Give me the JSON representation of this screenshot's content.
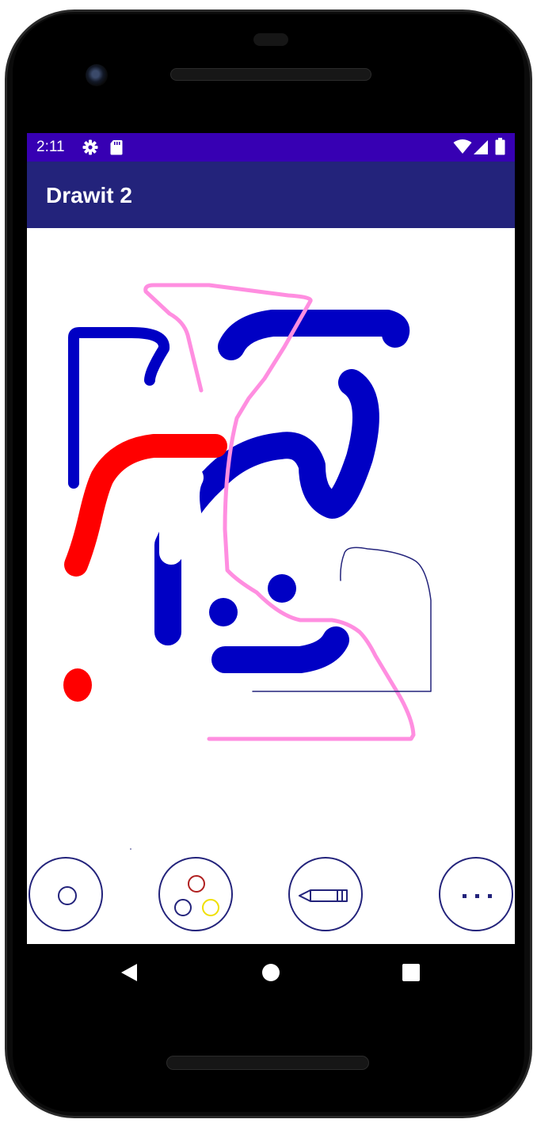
{
  "status_bar": {
    "time": "2:11",
    "background": "#3700b3",
    "left_icons": [
      "settings-gear-icon",
      "sd-card-icon"
    ],
    "right_icons": [
      "wifi-icon",
      "cellular-signal-icon",
      "battery-icon"
    ]
  },
  "app_bar": {
    "title": "Drawit 2",
    "background": "#23237b"
  },
  "canvas": {
    "background": "#ffffff",
    "stroke_colors": [
      "#0000c4",
      "#ff0000",
      "#ff8ee0",
      "#23237b"
    ]
  },
  "toolbar": {
    "buttons": [
      {
        "name": "brush-size",
        "icon": "circle-icon"
      },
      {
        "name": "color-palette",
        "icon": "palette-circles-icon"
      },
      {
        "name": "pencil-tool",
        "icon": "pencil-icon"
      },
      {
        "name": "more-options",
        "icon": "more-horizontal-icon"
      }
    ],
    "accent_color": "#23237b"
  },
  "nav_bar": {
    "buttons": [
      "back-icon",
      "home-icon",
      "recents-icon"
    ]
  }
}
